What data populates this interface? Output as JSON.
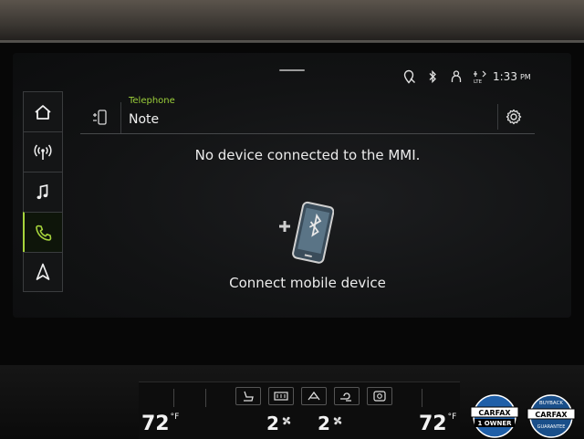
{
  "status_bar": {
    "time": "1:33",
    "ampm": "PM",
    "icons": [
      "location-off-icon",
      "bluetooth-icon",
      "user-icon",
      "lte-icon"
    ]
  },
  "sidebar": {
    "items": [
      {
        "name": "home",
        "icon": "home-icon",
        "active": false
      },
      {
        "name": "radio",
        "icon": "radio-icon",
        "active": false
      },
      {
        "name": "music",
        "icon": "music-icon",
        "active": false
      },
      {
        "name": "telephone",
        "icon": "phone-icon",
        "active": true
      },
      {
        "name": "navigation",
        "icon": "navigation-icon",
        "active": false
      }
    ]
  },
  "header": {
    "category": "Telephone",
    "title": "Note"
  },
  "main": {
    "message": "No device connected to the MMI.",
    "connect_label": "Connect mobile device"
  },
  "climate": {
    "left_temp": "72",
    "right_temp": "72",
    "temp_unit": "°F",
    "left_fan": "2",
    "right_fan": "2"
  },
  "badges": {
    "carfax_owner": [
      "CARFAX",
      "1 OWNER"
    ],
    "carfax_buyback": [
      "BUYBACK",
      "CARFAX",
      "GUARANTEE"
    ]
  },
  "colors": {
    "accent": "#9ccf3a",
    "text": "#ececec",
    "divider": "#46484a"
  }
}
